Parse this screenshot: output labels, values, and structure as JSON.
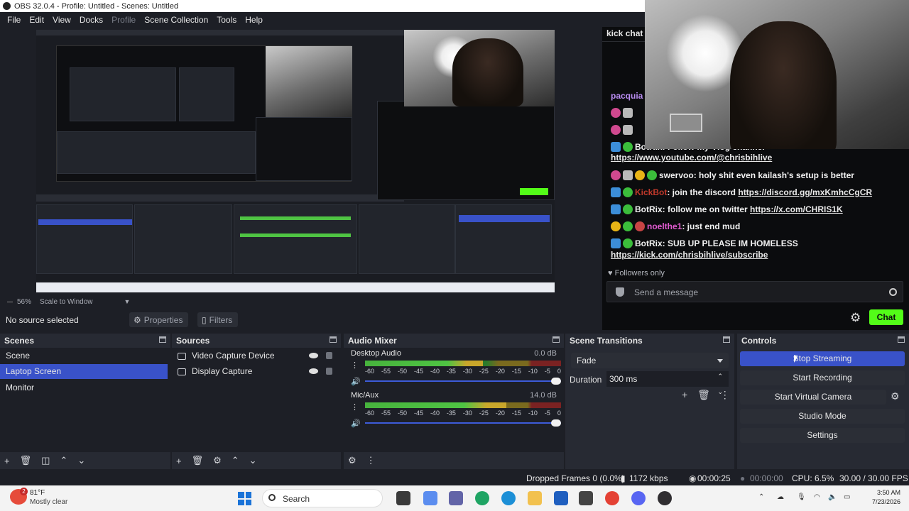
{
  "window": {
    "title": "OBS 32.0.4 - Profile: Untitled - Scenes: Untitled"
  },
  "menu": [
    {
      "label": "File",
      "enabled": true
    },
    {
      "label": "Edit",
      "enabled": true
    },
    {
      "label": "View",
      "enabled": true
    },
    {
      "label": "Docks",
      "enabled": true
    },
    {
      "label": "Profile",
      "enabled": false
    },
    {
      "label": "Scene Collection",
      "enabled": true
    },
    {
      "label": "Tools",
      "enabled": true
    },
    {
      "label": "Help",
      "enabled": true
    }
  ],
  "preview": {
    "zoom": "56%",
    "scale_mode": "Scale to Window"
  },
  "source_toolbar": {
    "no_source": "No source selected",
    "properties": "Properties",
    "filters": "Filters"
  },
  "chat": {
    "title": "kick chat",
    "top_user": "pacquia",
    "messages": [
      {
        "user": "BotRix",
        "text": ": Follow my Vlog channel",
        "link": "https://www.youtube.com/@chrisbihlive",
        "badges": [
          "blue",
          "green"
        ],
        "user_color": "#e8e8e8"
      },
      {
        "user": "swervoo",
        "text": ": holy shit even kailash's setup is better",
        "link": "",
        "badges": [
          "pink",
          "gray",
          "yellow",
          "green"
        ],
        "user_color": "#f0f0f0"
      },
      {
        "user": "KickBot",
        "text": ": join the discord ",
        "link": "https://discord.gg/mxKmhcCgCR",
        "badges": [
          "blue",
          "green"
        ],
        "user_color": "#c0392b"
      },
      {
        "user": "BotRix",
        "text": ": follow me on twitter ",
        "link": "https://x.com/CHRIS1K",
        "badges": [
          "blue",
          "green"
        ],
        "user_color": "#f0f0f0"
      },
      {
        "user": "noelthe1",
        "text": ": just end mud",
        "link": "",
        "badges": [
          "yellow",
          "green",
          "red"
        ],
        "user_color": "#e15ad0"
      },
      {
        "user": "BotRix",
        "text": ": SUB UP PLEASE IM HOMELESS",
        "link": "https://kick.com/chrisbihlive/subscribe",
        "badges": [
          "blue",
          "green"
        ],
        "user_color": "#f0f0f0"
      }
    ],
    "followers_only": "Followers only",
    "send_placeholder": "Send a message",
    "chat_button": "Chat",
    "colors": {
      "accent": "#53fc18"
    }
  },
  "docks": {
    "scenes": {
      "title": "Scenes",
      "items": [
        {
          "label": "Scene",
          "selected": false
        },
        {
          "label": "Laptop Screen",
          "selected": true
        },
        {
          "label": "Monitor",
          "selected": false
        }
      ]
    },
    "sources": {
      "title": "Sources",
      "items": [
        {
          "label": "Video Capture Device",
          "icon": "camera-icon"
        },
        {
          "label": "Display Capture",
          "icon": "monitor-icon"
        }
      ]
    },
    "audio_mixer": {
      "title": "Audio Mixer",
      "channels": [
        {
          "name": "Desktop Audio",
          "db": "0.0 dB",
          "level": 0.6,
          "volume": 1.0
        },
        {
          "name": "Mic/Aux",
          "db": "14.0 dB",
          "level": 0.72,
          "volume": 1.0
        }
      ],
      "ticks": [
        "-60",
        "-55",
        "-50",
        "-45",
        "-40",
        "-35",
        "-30",
        "-25",
        "-20",
        "-15",
        "-10",
        "-5",
        "0"
      ]
    },
    "transitions": {
      "title": "Scene Transitions",
      "selected": "Fade",
      "duration_label": "Duration",
      "duration_value": "300 ms"
    },
    "controls": {
      "title": "Controls",
      "buttons": [
        "Stop Streaming",
        "Start Recording",
        "Start Virtual Camera",
        "Studio Mode",
        "Settings"
      ]
    }
  },
  "status": {
    "dropped": "Dropped Frames 0 (0.0%)",
    "bitrate": "1172 kbps",
    "stream_time": "00:00:25",
    "rec_time": "00:00:00",
    "cpu": "CPU: 6.5%",
    "fps": "30.00 / 30.00 FPS"
  },
  "taskbar": {
    "weather_temp": "81°F",
    "weather_desc": "Mostly clear",
    "notif_count": "2",
    "search_label": "Search",
    "time": "3:50 AM",
    "date": "7/23/2026"
  },
  "colors": {
    "selection": "#3952c9",
    "panel_bg": "#272a33",
    "base_bg": "#1d1f26"
  }
}
